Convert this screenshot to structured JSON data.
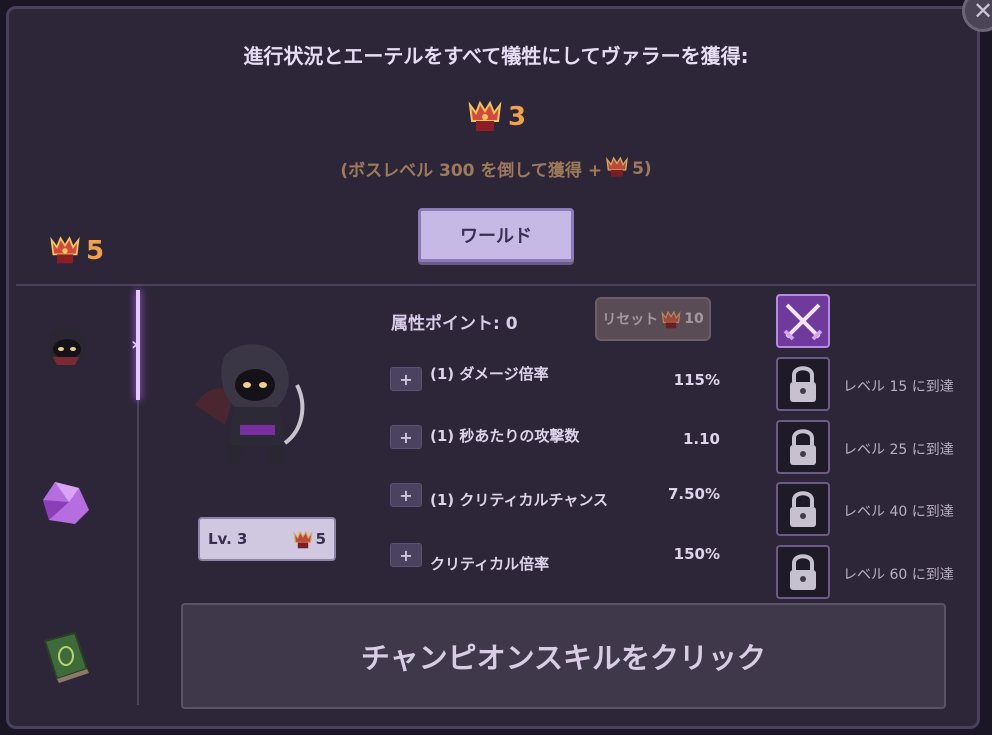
{
  "header": {
    "title": "進行状況とエーテルをすべて犠牲にしてヴァラーを獲得:"
  },
  "valor_gain": "3",
  "boss_note": {
    "prefix": "(ボスレベル 300 を倒して獲得 +",
    "amount": "5)"
  },
  "world_button_label": "ワールド",
  "current_valor": "5",
  "attributes": {
    "points_label": "属性ポイント: 0",
    "reset_label": "リセット",
    "reset_cost": "10",
    "stats": [
      {
        "name": "(1) ダメージ倍率",
        "value": "115%"
      },
      {
        "name": "(1) 秒あたりの攻撃数",
        "value": "1.10"
      },
      {
        "name": "(1) クリティカルチャンス",
        "value": "7.50%"
      },
      {
        "name": "クリティカル倍率",
        "value": "150%"
      }
    ],
    "plus_glyph": "+"
  },
  "champion": {
    "level_label": "Lv. 3",
    "upgrade_cost": "5"
  },
  "skills": [
    {
      "icon": "crossed-swords-icon",
      "locked": false,
      "requirement": ""
    },
    {
      "icon": "lock-icon",
      "locked": true,
      "requirement": "レベル 15 に到達"
    },
    {
      "icon": "lock-icon",
      "locked": true,
      "requirement": "レベル 25 に到達"
    },
    {
      "icon": "lock-icon",
      "locked": true,
      "requirement": "レベル 40 に到達"
    },
    {
      "icon": "lock-icon",
      "locked": true,
      "requirement": "レベル 60 に到達"
    }
  ],
  "sidebar": [
    {
      "icon": "hooded-ninja-icon",
      "active": true
    },
    {
      "icon": "purple-gem-icon",
      "active": false
    },
    {
      "icon": "spellbook-icon",
      "active": false
    }
  ],
  "bottom_button_label": "チャンピオンスキルをクリック",
  "close_glyph": "✕",
  "colors": {
    "background": "#2d2638",
    "accent": "#f0a24b",
    "button_light": "#c7b9e5",
    "active_skill": "#6f3a9c"
  }
}
